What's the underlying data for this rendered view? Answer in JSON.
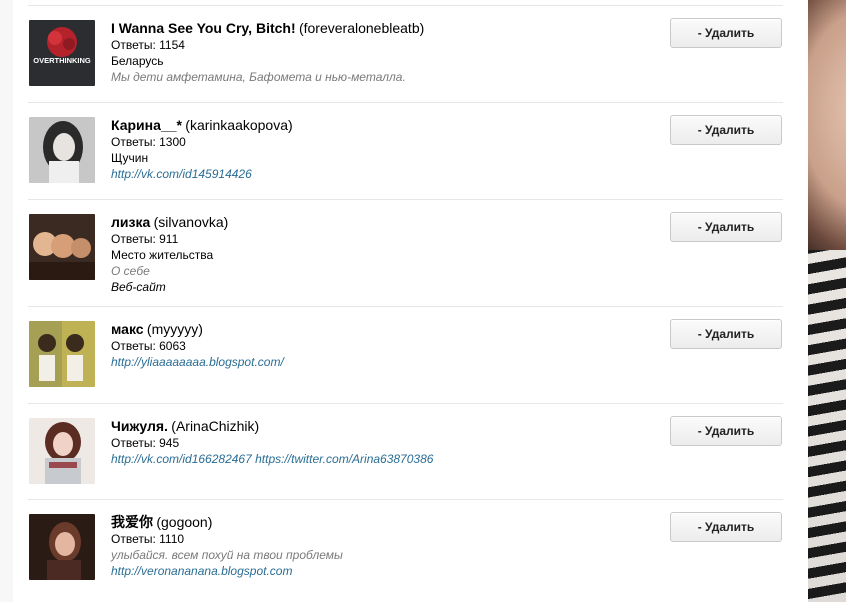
{
  "delete_label": "- Удалить",
  "followers": [
    {
      "name": "I Wanna See You Cry, Bitch!",
      "login": "(foreveralonebleatb)",
      "answers": "Ответы: 1154",
      "lines": [
        {
          "text": "Беларусь",
          "style": "plain"
        },
        {
          "text": "Мы дети амфетамина, Бафомета и нью-металла.",
          "style": "muted"
        }
      ],
      "avatar_text": "OVERTHINKING"
    },
    {
      "name": "Карина__*",
      "login": "(karinkaakopova)",
      "answers": "Ответы: 1300",
      "lines": [
        {
          "text": "Щучин",
          "style": "plain"
        },
        {
          "text": "http://vk.com/id145914426",
          "style": "link"
        }
      ]
    },
    {
      "name": "лизка",
      "login": "(silvanovka)",
      "answers": "Ответы: 911",
      "lines": [
        {
          "text": "Место жительства",
          "style": "plain"
        },
        {
          "text": "О себе",
          "style": "muted"
        },
        {
          "text": "Веб-сайт",
          "style": "italic"
        }
      ]
    },
    {
      "name": "макс",
      "login": "(myyyyy)",
      "answers": "Ответы: 6063",
      "lines": [
        {
          "text": "http://yliaaaaaaaa.blogspot.com/",
          "style": "link"
        }
      ]
    },
    {
      "name": "Чижуля.",
      "login": "(ArinaChizhik)",
      "answers": "Ответы: 945",
      "lines": [
        {
          "text": "http://vk.com/id166282467",
          "style": "link"
        },
        {
          "text": "https://twitter.com/Arina63870386",
          "style": "link"
        }
      ]
    },
    {
      "name": "我爱你",
      "login": "(gogoon)",
      "answers": "Ответы: 1110",
      "lines": [
        {
          "text": "улыбайся. всем похуй на твои проблемы",
          "style": "muted"
        },
        {
          "text": "http://veronananana.blogspot.com",
          "style": "link"
        }
      ]
    }
  ]
}
